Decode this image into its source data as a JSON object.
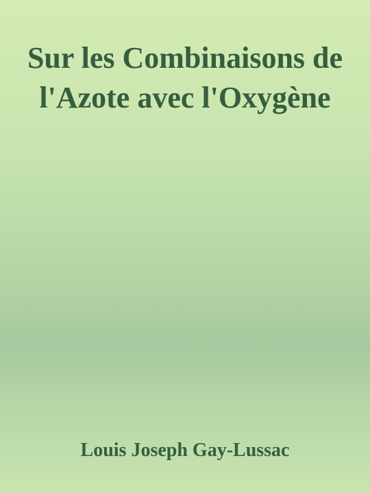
{
  "cover": {
    "title": "Sur les Combinaisons de l'Azote avec l'Oxygène",
    "author": "Louis Joseph Gay-Lussac",
    "colors": {
      "text": "#355e3f",
      "background_top": "#d4ecb4",
      "background_band": "#a6c89e"
    }
  }
}
